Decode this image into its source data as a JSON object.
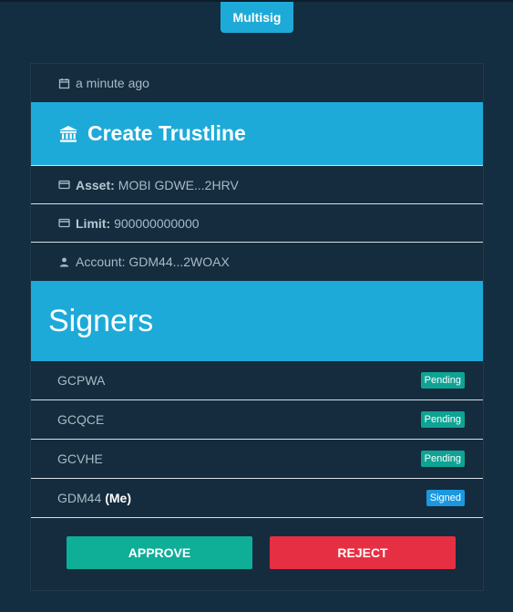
{
  "tab": {
    "label": "Multisig"
  },
  "meta": {
    "time": "a minute ago"
  },
  "operation": {
    "title": "Create Trustline"
  },
  "details": {
    "asset_label": "Asset:",
    "asset_value": "MOBI GDWE...2HRV",
    "limit_label": "Limit:",
    "limit_value": "900000000000",
    "account_text": "Account: GDM44...2WOAX"
  },
  "signers": {
    "heading": "Signers",
    "items": [
      {
        "key": "GCPWA",
        "me": "",
        "status": "Pending"
      },
      {
        "key": "GCQCE",
        "me": "",
        "status": "Pending"
      },
      {
        "key": "GCVHE",
        "me": "",
        "status": "Pending"
      },
      {
        "key": "GDM44",
        "me": "(Me)",
        "status": "Signed"
      }
    ]
  },
  "actions": {
    "approve_label": "APPROVE",
    "reject_label": "REJECT"
  },
  "colors": {
    "background": "#142e41",
    "accent": "#1eaad8",
    "pending": "#0fa394",
    "signed": "#1b98e0",
    "approve": "#0fae97",
    "reject": "#e72f44"
  },
  "icons": {
    "time": "calendar-icon",
    "title": "bank-icon",
    "asset": "card-icon",
    "limit": "card-icon",
    "account": "person-icon"
  }
}
